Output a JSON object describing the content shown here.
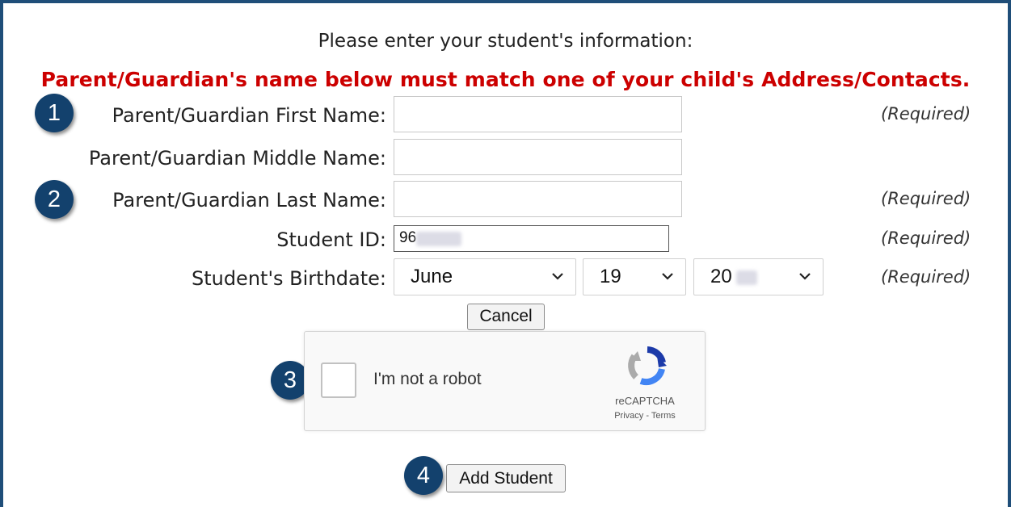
{
  "header": {
    "instruction": "Please enter your student's information:",
    "warning": "Parent/Guardian's name below must match one of your child's Address/Contacts."
  },
  "form": {
    "first_name": {
      "label": "Parent/Guardian First Name:",
      "value": "",
      "note": "(Required)"
    },
    "middle_name": {
      "label": "Parent/Guardian Middle Name:",
      "value": ""
    },
    "last_name": {
      "label": "Parent/Guardian Last Name:",
      "value": "",
      "note": "(Required)"
    },
    "student_id": {
      "label": "Student ID:",
      "value": "96",
      "note": "(Required)"
    },
    "birthdate": {
      "label": "Student's Birthdate:",
      "month": "June",
      "day": "19",
      "year": "20",
      "note": "(Required)"
    }
  },
  "buttons": {
    "cancel": "Cancel",
    "add_student": "Add Student"
  },
  "recaptcha": {
    "checkbox_label": "I'm not a robot",
    "brand": "reCAPTCHA",
    "links": "Privacy - Terms"
  },
  "steps": [
    "1",
    "2",
    "3",
    "4"
  ],
  "colors": {
    "warning": "#cc0000",
    "badge": "#13416d",
    "frame": "#1f4e79"
  }
}
